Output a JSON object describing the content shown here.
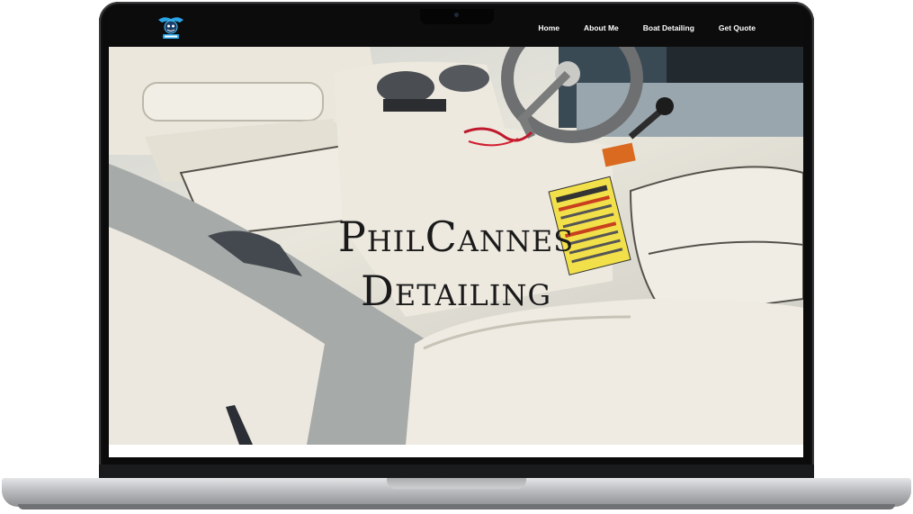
{
  "nav": {
    "logo_icon": "boat-detailing-logo-icon",
    "links": [
      "Home",
      "About Me",
      "Boat Detailing",
      "Get Quote"
    ]
  },
  "hero": {
    "title_line1": "PhilCannes",
    "title_line2": "Detailing",
    "background": "boat-interior-photo"
  },
  "colors": {
    "navbar": "#0c0c0c",
    "nav_text": "#ffffff",
    "hero_text": "#1a1a1a"
  }
}
